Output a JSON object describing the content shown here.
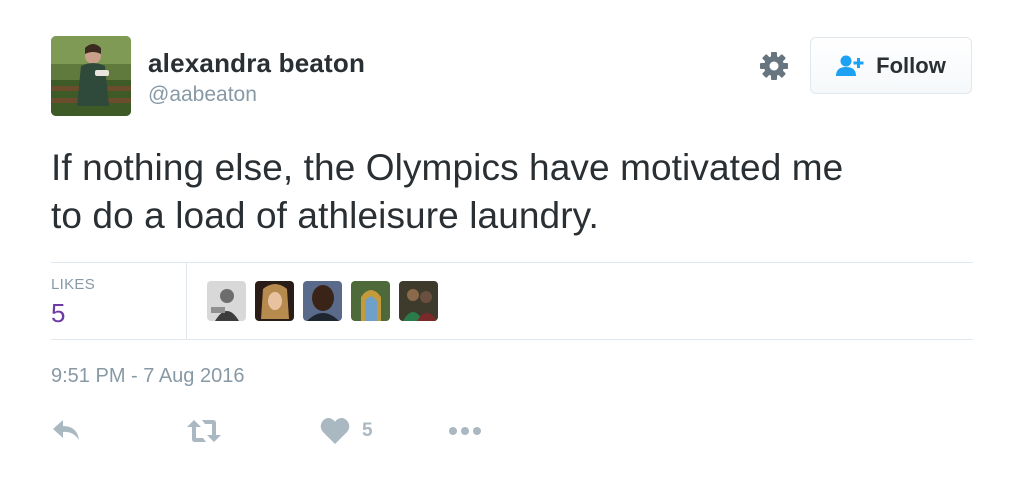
{
  "user": {
    "name": "alexandra beaton",
    "handle": "@aabeaton"
  },
  "follow_button": {
    "label": "Follow",
    "icon": "follow-user-plus-icon"
  },
  "settings": {
    "icon": "gear-icon"
  },
  "tweet": {
    "text_line1": "If nothing else, the Olympics have motivated me",
    "text_line2": "to do a load of athleisure laundry.",
    "timestamp": "9:51 PM - 7 Aug 2016"
  },
  "stats": {
    "likes_label": "LIKES",
    "likes_count": "5"
  },
  "likers_count": 5,
  "actions": {
    "reply_icon": "reply-icon",
    "retweet_icon": "retweet-icon",
    "like_icon": "heart-icon",
    "like_count": "5",
    "more_icon": "more-dots-icon"
  },
  "colors": {
    "text": "#292f33",
    "muted": "#8899a6",
    "likes_count": "#6e3aa3",
    "action_icon": "#aab8c2",
    "follow_icon": "#1da1f2",
    "divider": "#e1e8ed"
  }
}
